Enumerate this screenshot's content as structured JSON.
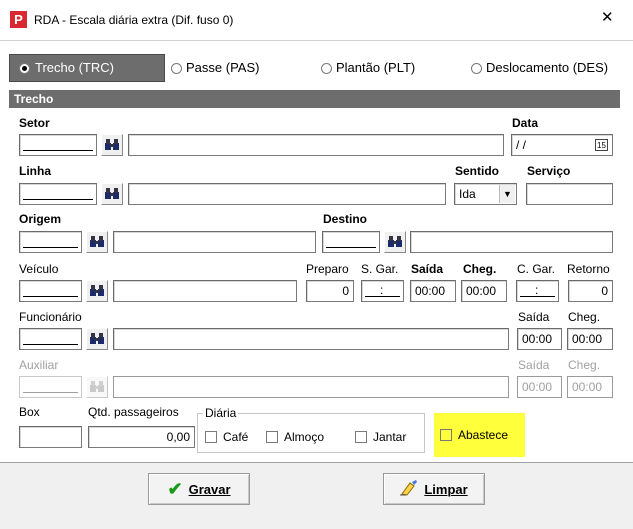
{
  "window": {
    "title": "RDA - Escala diária extra (Dif. fuso 0)",
    "close_glyph": "✕",
    "app_icon": "P"
  },
  "tabs": [
    {
      "label": "Trecho (TRC)",
      "selected": true
    },
    {
      "label": "Passe (PAS)",
      "selected": false
    },
    {
      "label": "Plantão (PLT)",
      "selected": false
    },
    {
      "label": "Deslocamento (DES)",
      "selected": false
    }
  ],
  "section": {
    "title": "Trecho"
  },
  "form": {
    "setor_label": "Setor",
    "data_label": "Data",
    "data_value": "/ /",
    "calendar_glyph": "15",
    "linha_label": "Linha",
    "sentido_label": "Sentido",
    "sentido_value": "Ida",
    "servico_label": "Serviço",
    "origem_label": "Origem",
    "destino_label": "Destino",
    "veiculo_label": "Veículo",
    "preparo_label": "Preparo",
    "preparo_value": "0",
    "sgar_label": "S. Gar.",
    "sgar_value": ":",
    "saida_label": "Saída",
    "saida_value": "00:00",
    "cheg_label": "Cheg.",
    "cheg_value": "00:00",
    "cgar_label": "C. Gar.",
    "cgar_value": ":",
    "retorno_label": "Retorno",
    "retorno_value": "0",
    "funcionario_label": "Funcionário",
    "func_saida_label": "Saída",
    "func_cheg_label": "Cheg.",
    "func_saida_value": "00:00",
    "func_cheg_value": "00:00",
    "auxiliar_label": "Auxiliar",
    "aux_saida_label": "Saída",
    "aux_cheg_label": "Cheg.",
    "aux_saida_value": "00:00",
    "aux_cheg_value": "00:00",
    "box_label": "Box",
    "qtd_label": "Qtd. passageiros",
    "qtd_value": "0,00",
    "diaria_label": "Diária",
    "cafe_label": "Café",
    "almoco_label": "Almoço",
    "jantar_label": "Jantar",
    "abastece_label": "Abastece"
  },
  "buttons": {
    "gravar": "Gravar",
    "limpar": "Limpar"
  },
  "colors": {
    "highlight": "#ffff3c",
    "app_icon_bg": "#d9282f",
    "tab_selected_bg": "#6d6d6d"
  }
}
